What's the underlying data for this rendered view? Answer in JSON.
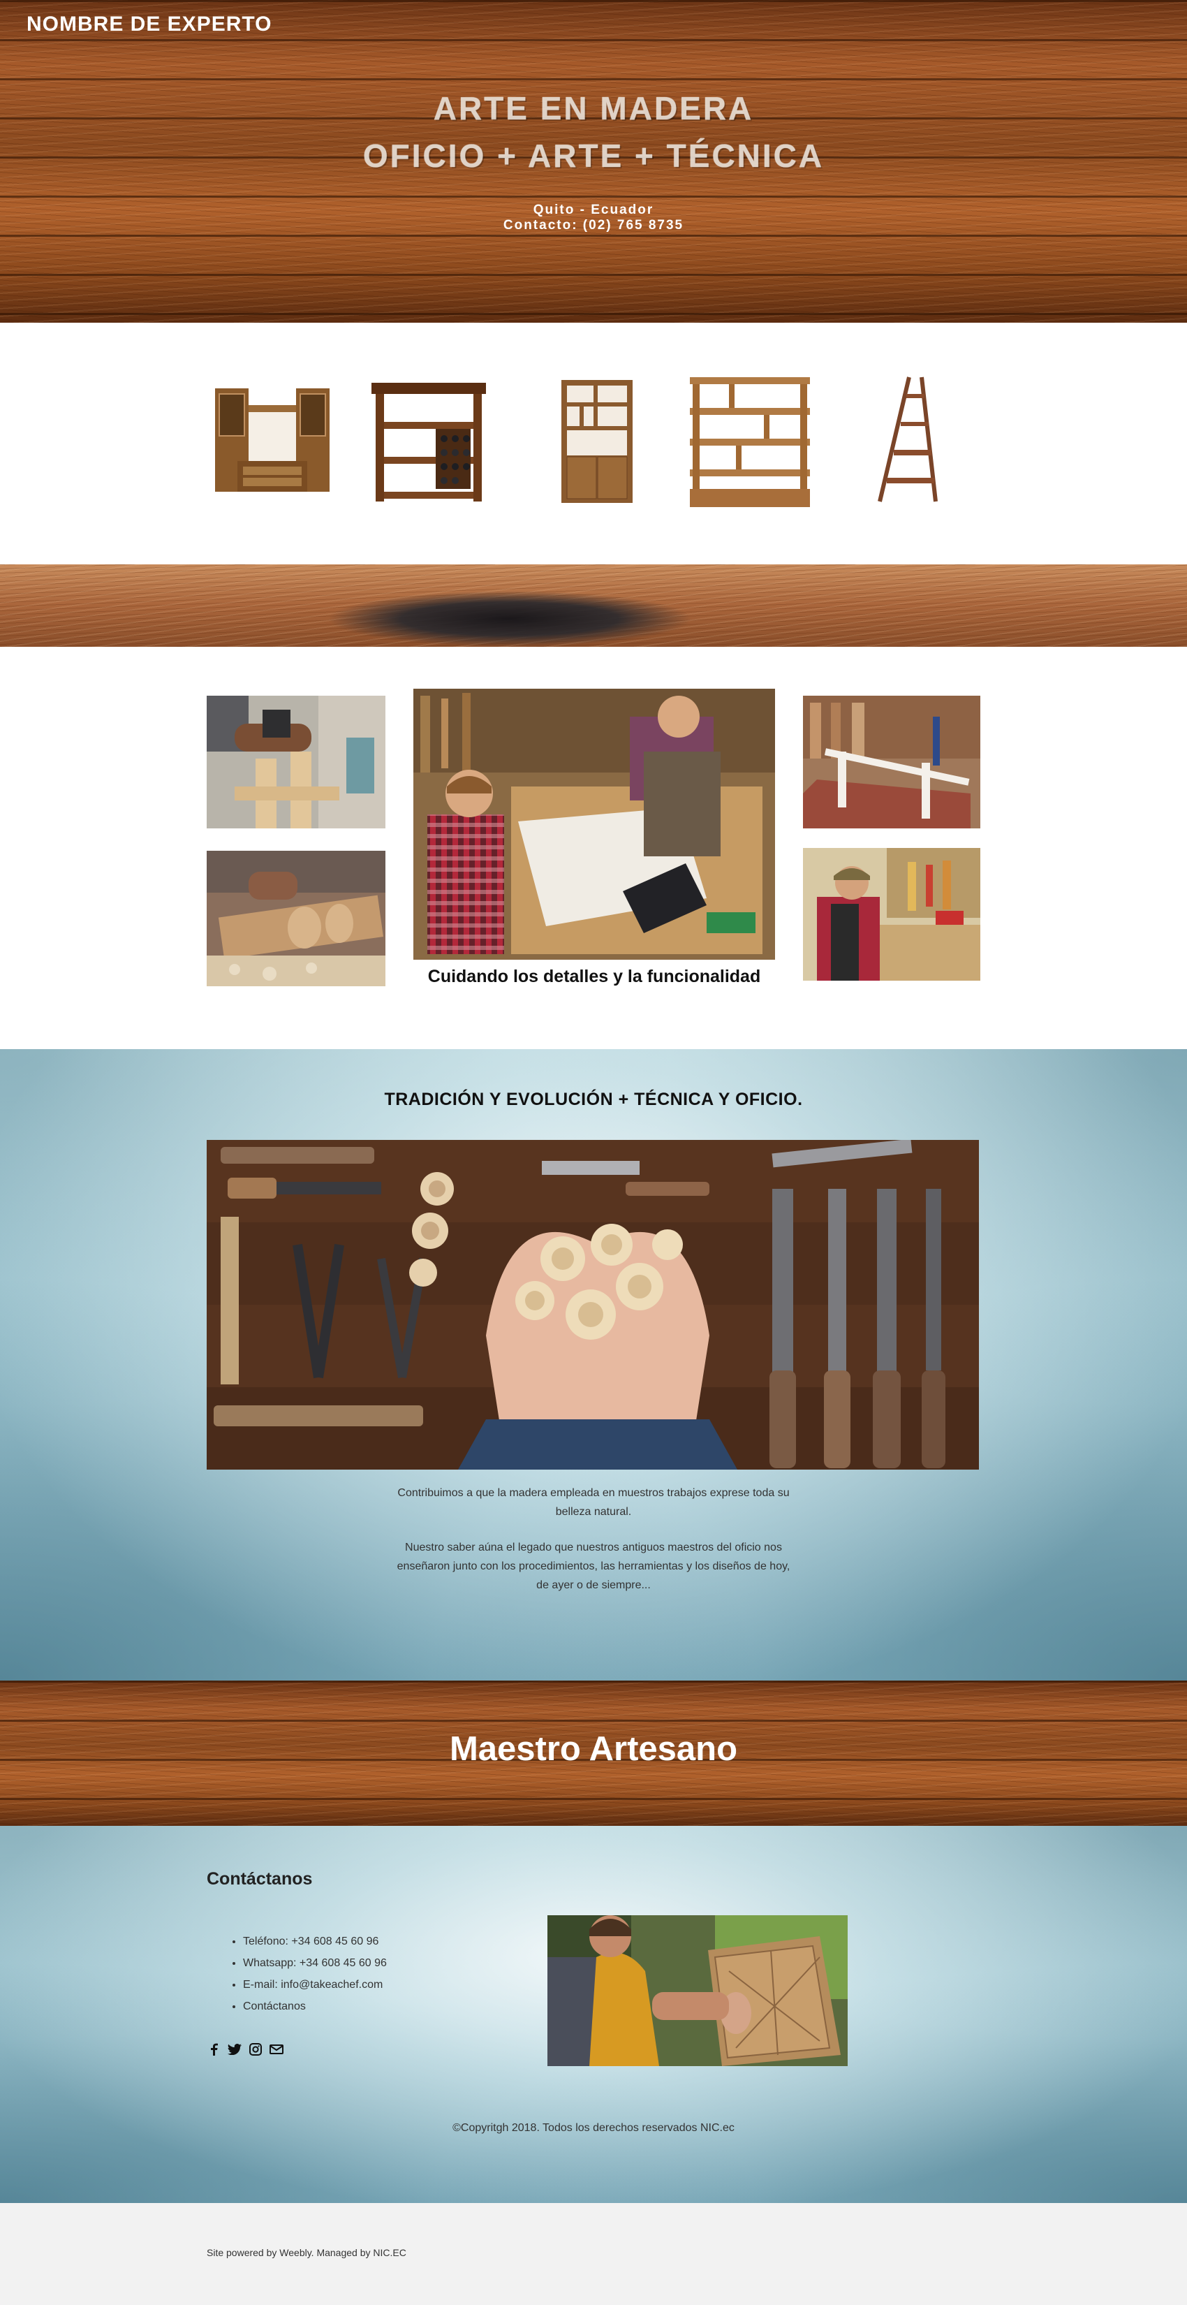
{
  "header": {
    "site_title": "NOMBRE DE EXPERTO",
    "line1": "ARTE EN MADERA",
    "line2": "OFICIO + ARTE + TÉCNICA",
    "location": "Quito - Ecuador",
    "contact": "Contacto: (02) 765 8735"
  },
  "gallery": {
    "caption": "Cuidando los detalles y la funcionalidad"
  },
  "tradition": {
    "title": "TRADICIÓN Y EVOLUCIÓN + TÉCNICA Y OFICIO.",
    "paragraph1": "Contribuimos a que la madera empleada en muestros trabajos exprese toda su belleza natural.",
    "paragraph2": "Nuestro saber aúna el legado que nuestros antiguos maestros del oficio nos enseñaron junto con los procedimientos, las herramientas y los diseños de hoy, de ayer o de siempre..."
  },
  "maestro": {
    "title": "Maestro Artesano"
  },
  "contact": {
    "title": "Contáctanos",
    "items": [
      "Teléfono: +34 608 45 60 96",
      "Whatsapp: +34 608 45 60 96",
      "E-mail: info@takeachef.com",
      "Contáctanos"
    ],
    "social": [
      "facebook-icon",
      "twitter-icon",
      "instagram-icon",
      "mail-icon"
    ],
    "copyright": "©Copyritgh 2018. Todos los derechos reservados NIC.ec"
  },
  "footer": {
    "text": "Site powered by Weebly. Managed by NIC.EC"
  }
}
